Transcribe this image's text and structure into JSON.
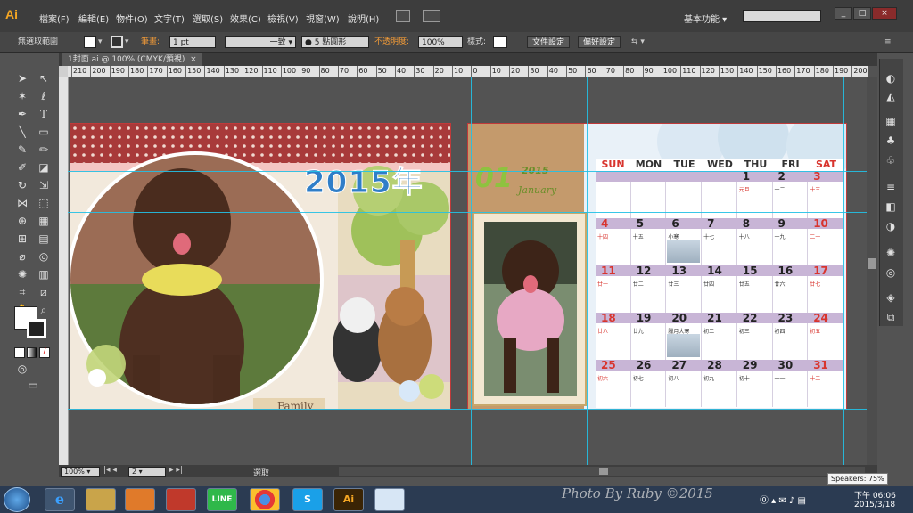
{
  "app": {
    "logo": "Ai"
  },
  "menu": [
    "檔案(F)",
    "編輯(E)",
    "物件(O)",
    "文字(T)",
    "選取(S)",
    "效果(C)",
    "檢視(V)",
    "視窗(W)",
    "說明(H)"
  ],
  "workspace": "基本功能",
  "control_bar": {
    "selection": "無選取範圍",
    "stroke_label": "筆畫:",
    "stroke_weight": "1 pt",
    "stroke_style": "一致",
    "brush": "5 點圓形",
    "opacity_label": "不透明度:",
    "opacity_value": "100%",
    "style_label": "樣式:",
    "doc_setup_button": "文件設定",
    "preferences_button": "偏好設定"
  },
  "document_tab": {
    "title": "1封面.ai @ 100% (CMYK/預視)",
    "close": "×"
  },
  "ruler_ticks": [
    "210",
    "200",
    "190",
    "180",
    "170",
    "160",
    "150",
    "140",
    "130",
    "120",
    "110",
    "100",
    "90",
    "80",
    "70",
    "60",
    "50",
    "40",
    "30",
    "20",
    "10",
    "0",
    "10",
    "20",
    "30",
    "40",
    "50",
    "60",
    "70",
    "80",
    "90",
    "100",
    "110",
    "120",
    "130",
    "140",
    "150",
    "160",
    "170",
    "180",
    "190",
    "200"
  ],
  "status_bar": {
    "zoom": "100%",
    "page": "2",
    "mode": "選取"
  },
  "cover": {
    "year_title": "2015年",
    "banner": "Family"
  },
  "calendar_page": {
    "month_number": "01",
    "month_year": "2015",
    "month_name": "January"
  },
  "calendar": {
    "days_of_week": [
      "SUN",
      "MON",
      "TUE",
      "WED",
      "THU",
      "FRI",
      "SAT"
    ],
    "weeks": [
      {
        "days": [
          "",
          "",
          "",
          "",
          "1",
          "2",
          "3"
        ],
        "lunar": [
          "",
          "",
          "",
          "",
          "元旦",
          "十二",
          "十三"
        ]
      },
      {
        "days": [
          "4",
          "5",
          "6",
          "7",
          "8",
          "9",
          "10"
        ],
        "lunar": [
          "十四",
          "十五",
          "小寒",
          "十七",
          "十八",
          "十九",
          "二十"
        ]
      },
      {
        "days": [
          "11",
          "12",
          "13",
          "14",
          "15",
          "16",
          "17"
        ],
        "lunar": [
          "廿一",
          "廿二",
          "廿三",
          "廿四",
          "廿五",
          "廿六",
          "廿七"
        ]
      },
      {
        "days": [
          "18",
          "19",
          "20",
          "21",
          "22",
          "23",
          "24"
        ],
        "lunar": [
          "廿八",
          "廿九",
          "臘月大寒",
          "初二",
          "初三",
          "初四",
          "初五"
        ]
      },
      {
        "days": [
          "25",
          "26",
          "27",
          "28",
          "29",
          "30",
          "31"
        ],
        "lunar": [
          "初六",
          "初七",
          "初八",
          "初九",
          "初十",
          "十一",
          "十二"
        ]
      }
    ]
  },
  "taskbar": {
    "apps": [
      "e",
      "",
      "",
      "",
      "LINE",
      "",
      "S",
      "Ai",
      ""
    ],
    "time": "下午 06:06",
    "date": "2015/3/18",
    "tooltip": "Speakers: 75%",
    "watermark": "Photo By Ruby  ©2015"
  },
  "colors": {
    "accent_blue": "#22c1e6",
    "artboard_border": "#c03a3a",
    "weekend_red": "#d8342e",
    "week_bar": "#c8b5d6"
  }
}
